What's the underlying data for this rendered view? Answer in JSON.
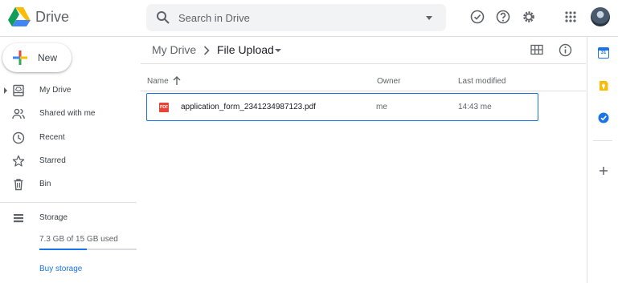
{
  "header": {
    "app_title": "Drive",
    "search": {
      "placeholder": "Search in Drive",
      "value": ""
    },
    "icons": [
      "offline-ready-icon",
      "help-icon",
      "settings-icon",
      "apps-grid-icon"
    ]
  },
  "sidebar": {
    "new_label": "New",
    "items": [
      {
        "label": "My Drive",
        "icon": "my-drive-icon"
      },
      {
        "label": "Shared with me",
        "icon": "people-icon"
      },
      {
        "label": "Recent",
        "icon": "clock-icon"
      },
      {
        "label": "Starred",
        "icon": "star-icon"
      },
      {
        "label": "Bin",
        "icon": "trash-icon"
      }
    ],
    "storage": {
      "label": "Storage",
      "usage_text": "7.3 GB of 15 GB used",
      "used_fraction": 0.487,
      "buy_label": "Buy storage"
    }
  },
  "breadcrumb": {
    "root": "My Drive",
    "current": "File Upload"
  },
  "table": {
    "columns": {
      "name": "Name",
      "owner": "Owner",
      "modified": "Last modified"
    },
    "rows": [
      {
        "icon_text": "PDF",
        "name": "application_form_2341234987123.pdf",
        "owner": "me",
        "modified": "14:43 me"
      }
    ]
  },
  "right_panel": {
    "calendar_day": "31",
    "apps": [
      "calendar-icon",
      "keep-icon",
      "tasks-icon",
      "add-icon"
    ]
  },
  "colors": {
    "accent": "#1a73e8",
    "pdf": "#ea4335",
    "keep": "#fbbc04"
  }
}
